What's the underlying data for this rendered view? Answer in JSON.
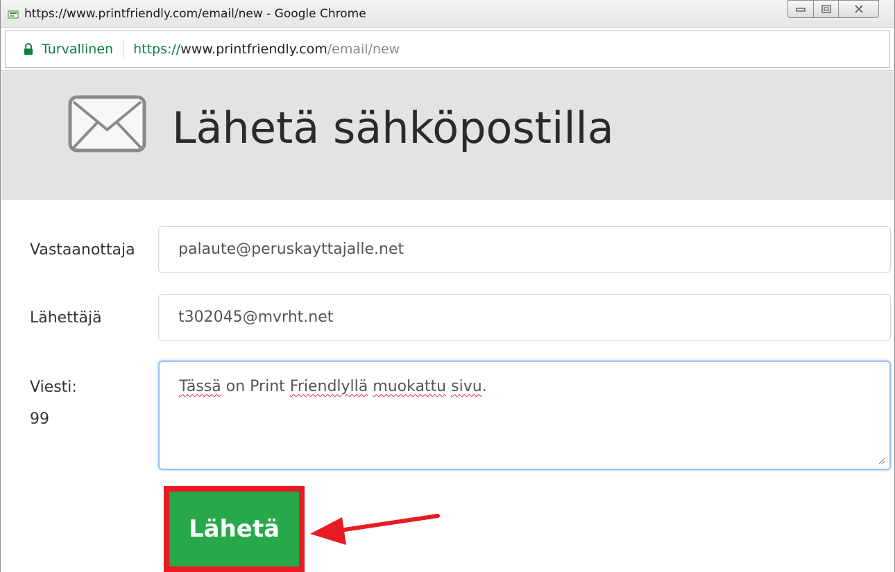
{
  "browser": {
    "title": "https://www.printfriendly.com/email/new - Google Chrome",
    "secure_label": "Turvallinen",
    "url_scheme": "https://",
    "url_host": "www.printfriendly.com",
    "url_path": "/email/new"
  },
  "page": {
    "title": "Lähetä sähköpostilla"
  },
  "form": {
    "recipient_label": "Vastaanottaja",
    "recipient_value": "palaute@peruskayttajalle.net",
    "sender_label": "Lähettäjä",
    "sender_value": "t302045@mvrht.net",
    "message_label": "Viesti:",
    "message_counter": "99",
    "message_words": [
      "Tässä",
      " on Print ",
      "Friendlyllä",
      " ",
      "muokattu",
      " ",
      "sivu",
      "."
    ],
    "send_label": "Lähetä"
  },
  "colors": {
    "send_button": "#27a84a",
    "highlight": "#e81b22",
    "secure_green": "#0b8043",
    "header_band": "#e3e3e3"
  },
  "icons": [
    "page-favicon-icon",
    "minimize-icon",
    "maximize-icon",
    "close-icon",
    "lock-icon",
    "envelope-icon",
    "resize-grip-icon",
    "arrow-annotation"
  ]
}
